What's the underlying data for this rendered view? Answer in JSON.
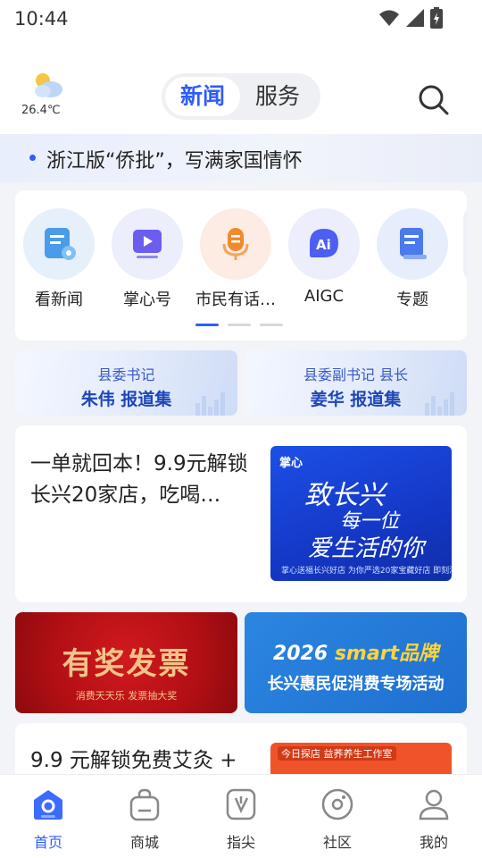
{
  "status": {
    "time": "10:44"
  },
  "weather": {
    "temp": "26.4℃",
    "icon": "partly-cloudy-icon"
  },
  "tabs": {
    "news": "新闻",
    "service": "服务"
  },
  "ticker": {
    "text": "浙江版“侨批”，写满家国情怀"
  },
  "quick_menu": [
    {
      "label": "看新闻",
      "icon": "read-news-icon",
      "color": "#e8f1fb"
    },
    {
      "label": "掌心号",
      "icon": "video-icon",
      "color": "#eef0fc"
    },
    {
      "label": "市民有话…",
      "icon": "microphone-icon",
      "color": "#fdeee6"
    },
    {
      "label": "AIGC",
      "icon": "ai-icon",
      "color": "#eef0fc"
    },
    {
      "label": "专题",
      "icon": "topic-icon",
      "color": "#eaf0fc"
    }
  ],
  "quick_menu_page": {
    "current": 1,
    "total": 3
  },
  "reports": [
    {
      "line1": "县委书记",
      "line2": "朱伟 报道集"
    },
    {
      "line1": "县委副书记 县长",
      "line2": "姜华 报道集"
    }
  ],
  "news_card": {
    "title": "一单就回本！9.9元解锁长兴20家店，吃喝…",
    "thumb": {
      "logo": "掌心",
      "line1": "致长兴",
      "line2": "每一位",
      "line3": "爱生活的你",
      "small": "掌心送福长兴好店 为你严选20家宝藏好店 即刻消费礼遇"
    }
  },
  "promo_red": {
    "title": "有奖发票",
    "subtitle": "消费天天乐 发票抽大奖"
  },
  "promo_blue": {
    "year": "2026",
    "smart": "smart",
    "brand": "品牌",
    "line2": "长兴惠民促消费专场活动"
  },
  "news_card2": {
    "title": "9.9 元解锁免费艾灸 +",
    "tag": "今日探店",
    "tag2": "益荞养生工作室"
  },
  "bottom_nav": [
    {
      "label": "首页",
      "icon": "home-icon",
      "active": true
    },
    {
      "label": "商城",
      "icon": "shopping-bag-icon",
      "active": false
    },
    {
      "label": "指尖",
      "icon": "fingertip-icon",
      "active": false
    },
    {
      "label": "社区",
      "icon": "community-icon",
      "active": false
    },
    {
      "label": "我的",
      "icon": "profile-icon",
      "active": false
    }
  ],
  "colors": {
    "accent": "#2f5cff",
    "ticker_bg": "#eef2fb",
    "promo_red": "#c41418",
    "promo_blue": "#2279d9"
  }
}
